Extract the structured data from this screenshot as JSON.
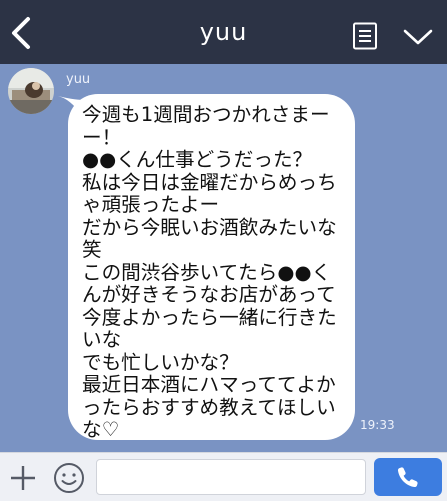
{
  "header": {
    "title": "yuu",
    "back_icon": "chevron-left-icon",
    "note_icon": "note-icon",
    "menu_icon": "chevron-down-icon",
    "background": "#2c3345"
  },
  "chat": {
    "background": "#7a93c3",
    "message": {
      "sender": "yuu",
      "text": "今週も1週間おつかれさまーー！\n●●くん仕事どうだった？\n私は今日は金曜だからめっちゃ頑張ったよー\nだから今眠いお酒飲みたいな笑\nこの間渋谷歩いてたら●●くんが好きそうなお店があって今度よかったら一緒に行きたいな\nでも忙しいかな？\n最近日本酒にハマっててよかったらおすすめ教えてほしいな♡",
      "time": "19:33"
    }
  },
  "input_bar": {
    "plus_icon": "plus-icon",
    "emoji_icon": "smiley-icon",
    "message_placeholder": "",
    "call_icon": "phone-icon",
    "call_color": "#3d7de0"
  }
}
